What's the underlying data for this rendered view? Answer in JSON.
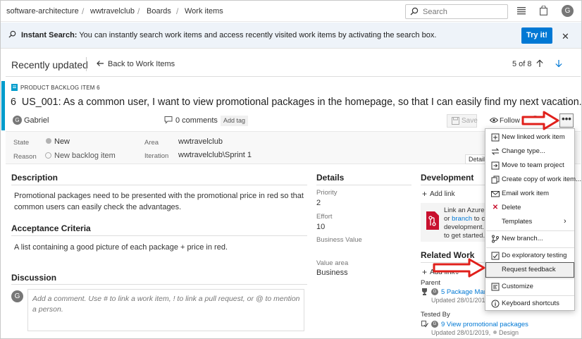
{
  "breadcrumb": [
    "software-architecture",
    "wwtravelclub",
    "Boards",
    "Work items"
  ],
  "search": {
    "placeholder": "Search"
  },
  "user_initial": "G",
  "banner": {
    "title": "Instant Search:",
    "text": " You can instantly search work items and access recently visited work items by activating the search box.",
    "button": "Try it!"
  },
  "header": {
    "recently_updated": "Recently updated",
    "back": "Back to Work Items",
    "pager": "5 of 8"
  },
  "work_item": {
    "type": "PRODUCT BACKLOG ITEM 6",
    "id": "6",
    "title": "US_001: As a common user, I want to view promotional packages in the homepage, so that I can easily find my next vacation.",
    "assignee": "Gabriel",
    "comments": "0 comments",
    "add_tag": "Add tag",
    "save": "Save",
    "follow": "Follow",
    "more": "•••"
  },
  "fields": {
    "state_label": "State",
    "state": "New",
    "reason_label": "Reason",
    "reason": "New backlog item",
    "area_label": "Area",
    "area": "wwtravelclub",
    "iteration_label": "Iteration",
    "iteration": "wwtravelclub\\Sprint 1",
    "details_tab": "Detail"
  },
  "description": {
    "title": "Description",
    "text": "Promotional packages need to be presented with the promotional price in red so that common users can easily check the advantages."
  },
  "acceptance": {
    "title": "Acceptance Criteria",
    "text": "A list containing a good picture of each package + price in red."
  },
  "discussion": {
    "title": "Discussion",
    "placeholder": "Add a comment. Use # to link a work item, ! to link a pull request, or @ to mention a person."
  },
  "details": {
    "title": "Details",
    "priority_label": "Priority",
    "priority": "2",
    "effort_label": "Effort",
    "effort": "10",
    "business_value_label": "Business Value",
    "value_area_label": "Value area",
    "value_area": "Business"
  },
  "development": {
    "title": "Development",
    "add_link": "Add link",
    "card_line1": "Link an Azure R",
    "card_line2_pre": "or ",
    "card_line2_link": "branch",
    "card_line2_post": " to create",
    "card_line3": "development. Y",
    "card_line4": "to get started."
  },
  "related": {
    "title": "Related Work",
    "add_link": "Add link",
    "parent_label": "Parent",
    "parent_item": "5 Package Manag",
    "parent_updated": "Updated 28/01/2019,",
    "tested_by_label": "Tested By",
    "tested_item": "9 View promotional packages",
    "tested_updated": "Updated 28/01/2019,",
    "tested_state": "Design"
  },
  "menu": [
    {
      "icon": "new-linked-icon",
      "label": "New linked work item"
    },
    {
      "icon": "change-type-icon",
      "label": "Change type..."
    },
    {
      "icon": "move-icon",
      "label": "Move to team project"
    },
    {
      "icon": "copy-icon",
      "label": "Create copy of work item..."
    },
    {
      "icon": "email-icon",
      "label": "Email work item"
    },
    {
      "icon": "delete-icon",
      "label": "Delete"
    },
    {
      "icon": "",
      "label": "Templates"
    },
    {
      "icon": "branch-icon",
      "label": "New branch..."
    },
    {
      "icon": "exploratory-icon",
      "label": "Do exploratory testing"
    },
    {
      "icon": "",
      "label": "Request feedback"
    },
    {
      "icon": "customize-icon",
      "label": "Customize"
    },
    {
      "icon": "info-icon",
      "label": "Keyboard shortcuts"
    }
  ],
  "colors": {
    "accent": "#0078d4",
    "work_item_bar": "#009ccc",
    "arrow_red": "#e0201b",
    "delete_red": "#c8102e"
  }
}
